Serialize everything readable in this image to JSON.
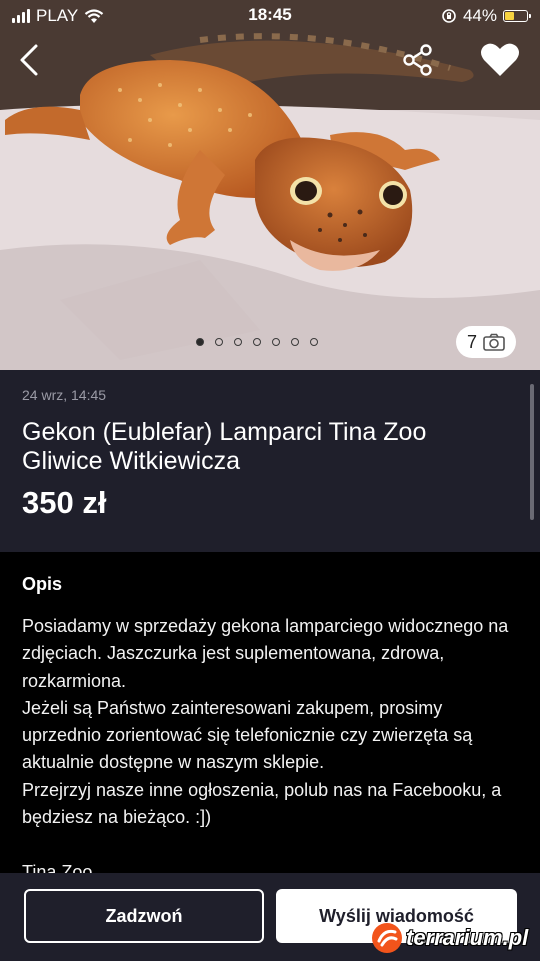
{
  "status_bar": {
    "carrier": "PLAY",
    "time": "18:45",
    "battery_percent": "44%",
    "battery_level": 0.44,
    "battery_color": "#f7d341"
  },
  "hero": {
    "icons": [
      "chevron-left-icon",
      "share-icon",
      "heart-icon",
      "camera-icon"
    ],
    "photo_count": "7",
    "total_photos": 7,
    "active_photo_index": 0
  },
  "listing": {
    "date": "24 wrz, 14:45",
    "title": "Gekon (Eublefar) Lamparci Tina Zoo Gliwice Witkiewicza",
    "price": "350 zł"
  },
  "description": {
    "heading": "Opis",
    "body": "Posiadamy w sprzedaży gekona lamparciego widocznego na zdjęciach. Jaszczurka jest suplementowana, zdrowa, rozkarmiona.\nJeżeli są Państwo zainteresowani zakupem, prosimy uprzednio zorientować się telefonicznie czy zwierzęta są aktualnie dostępne w naszym sklepie.\nPrzejrzyj nasze inne ogłoszenia, polub nas na Facebooku, a będziesz na bieżąco. :])",
    "seller": "Tina Zoo"
  },
  "actions": {
    "call_label": "Zadzwoń",
    "message_label": "Wyślij wiadomość"
  },
  "watermark": {
    "text": "terrarium.pl"
  },
  "colors": {
    "panel": "#1f1f2b",
    "background": "#000000",
    "watermark_orange": "#f2541b"
  }
}
